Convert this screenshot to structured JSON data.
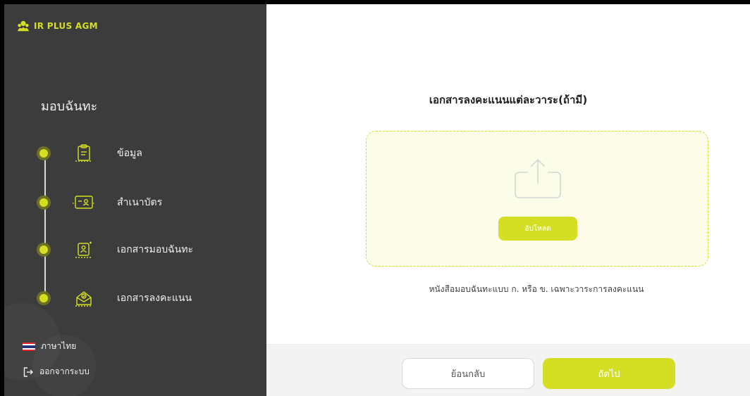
{
  "brand": {
    "name": "IR PLUS AGM"
  },
  "sidebar": {
    "title": "มอบฉันทะ",
    "steps": [
      {
        "label": "ข้อมูล",
        "icon": "clipboard-icon"
      },
      {
        "label": "สำเนาบัตร",
        "icon": "id-card-icon"
      },
      {
        "label": "เอกสารมอบฉันทะ",
        "icon": "user-document-icon"
      },
      {
        "label": "เอกสารลงคะแนน",
        "icon": "vote-envelope-icon"
      }
    ],
    "language": "ภาษาไทย",
    "logout": "ออกจากระบบ"
  },
  "main": {
    "title": "เอกสารลงคะแนนแต่ละวาระ(ถ้ามี)",
    "upload_label": "อัปโหลด",
    "note": "หนังสือมอบฉันทะแบบ ก. หรือ ข. เฉพาะวาระการลงคะแนน"
  },
  "footer": {
    "back_label": "ย้อนกลับ",
    "next_label": "ถัดไป"
  },
  "colors": {
    "accent": "#d4df23",
    "sidebar_bg": "#3b3c3b",
    "dropzone_bg": "#fcfde9"
  }
}
